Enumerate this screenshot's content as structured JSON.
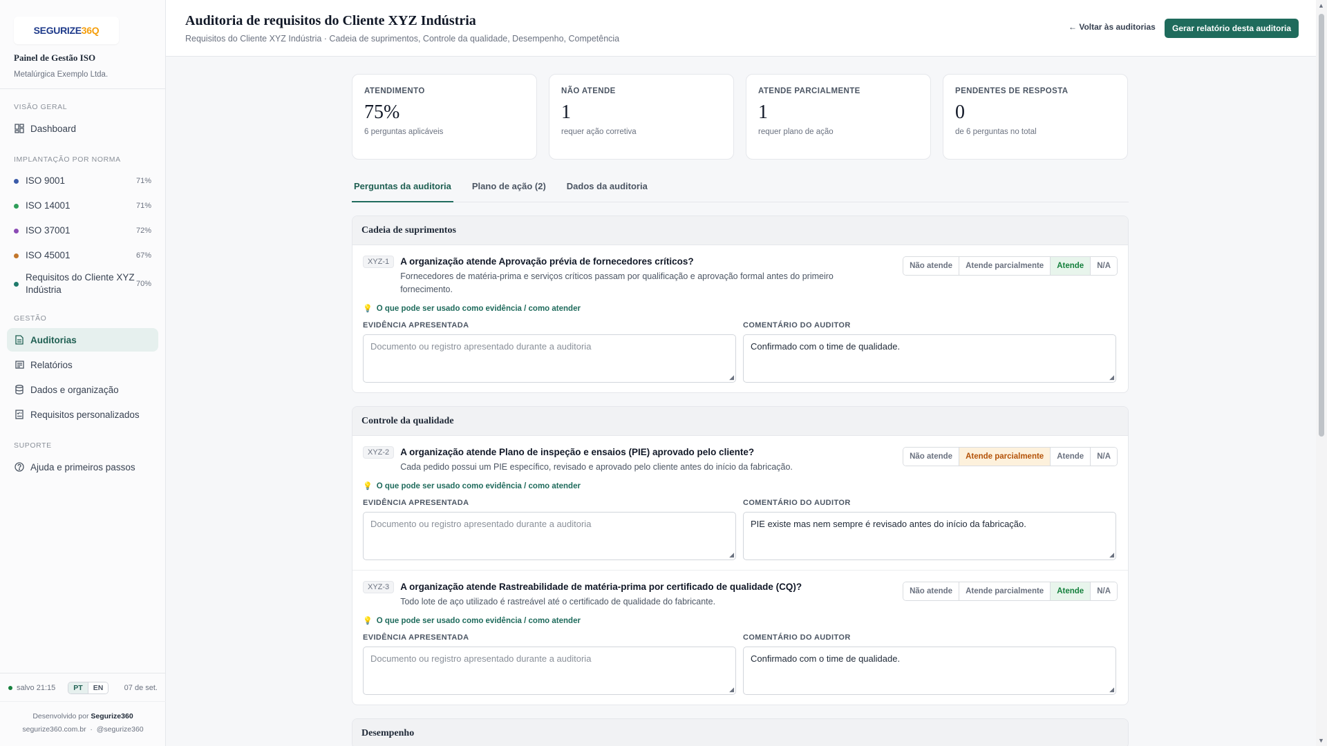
{
  "sidebar": {
    "logo": {
      "word": "SEGURIZE",
      "num": "36",
      "tail": "Q"
    },
    "panel_title": "Painel de Gestão ISO",
    "company": "Metalúrgica Exemplo Ltda.",
    "sections": {
      "overview": {
        "heading": "VISÃO GERAL",
        "dashboard": "Dashboard"
      },
      "norms": {
        "heading": "IMPLANTAÇÃO POR NORMA",
        "items": [
          {
            "label": "ISO 9001",
            "pct": "71%",
            "color": "#3b5ba9"
          },
          {
            "label": "ISO 14001",
            "pct": "71%",
            "color": "#2f9e5a"
          },
          {
            "label": "ISO 37001",
            "pct": "72%",
            "color": "#8b4bb5"
          },
          {
            "label": "ISO 45001",
            "pct": "67%",
            "color": "#c2762b"
          },
          {
            "label": "Requisitos do Cliente XYZ Indústria",
            "pct": "70%",
            "color": "#1f7a6b"
          }
        ]
      },
      "management": {
        "heading": "GESTÃO",
        "items": [
          "Auditorias",
          "Relatórios",
          "Dados e organização",
          "Requisitos personalizados"
        ]
      },
      "support": {
        "heading": "SUPORTE",
        "help": "Ajuda e primeiros passos"
      }
    },
    "footer": {
      "saved": "salvo 21:15",
      "lang_pt": "PT",
      "lang_en": "EN",
      "date": "07 de set.",
      "dev_prefix": "Desenvolvido por",
      "dev_name": "Segurize360",
      "site": "segurize360.com.br",
      "sep": "·",
      "handle": "@segurize360"
    }
  },
  "header": {
    "title": "Auditoria de requisitos do Cliente XYZ Indústria",
    "subtitle": "Requisitos do Cliente XYZ Indústria · Cadeia de suprimentos, Controle da qualidade, Desempenho, Competência",
    "back": "← Voltar às auditorias",
    "generate": "Gerar relatório desta auditoria"
  },
  "stats": [
    {
      "label": "ATENDIMENTO",
      "value": "75%",
      "sub": "6 perguntas aplicáveis"
    },
    {
      "label": "NÃO ATENDE",
      "value": "1",
      "sub": "requer ação corretiva"
    },
    {
      "label": "ATENDE PARCIALMENTE",
      "value": "1",
      "sub": "requer plano de ação"
    },
    {
      "label": "PENDENTES DE RESPOSTA",
      "value": "0",
      "sub": "de 6 perguntas no total"
    }
  ],
  "tabs": [
    "Perguntas da auditoria",
    "Plano de ação (2)",
    "Dados da auditoria"
  ],
  "answer_options": [
    "Não atende",
    "Atende parcialmente",
    "Atende",
    "N/A"
  ],
  "hint_text": "O que pode ser usado como evidência / como atender",
  "evidence_label": "EVIDÊNCIA APRESENTADA",
  "comment_label": "COMENTÁRIO DO AUDITOR",
  "evidence_placeholder": "Documento ou registro apresentado durante a auditoria",
  "groups": [
    {
      "title": "Cadeia de suprimentos",
      "questions": [
        {
          "code": "XYZ-1",
          "title": "A organização atende Aprovação prévia de fornecedores críticos?",
          "desc": "Fornecedores de matéria-prima e serviços críticos passam por qualificação e aprovação formal antes do primeiro fornecimento.",
          "selected": "Atende",
          "comment": "Confirmado com o time de qualidade."
        }
      ]
    },
    {
      "title": "Controle da qualidade",
      "questions": [
        {
          "code": "XYZ-2",
          "title": "A organização atende Plano de inspeção e ensaios (PIE) aprovado pelo cliente?",
          "desc": "Cada pedido possui um PIE específico, revisado e aprovado pelo cliente antes do início da fabricação.",
          "selected": "Atende parcialmente",
          "comment": "PIE existe mas nem sempre é revisado antes do início da fabricação."
        },
        {
          "code": "XYZ-3",
          "title": "A organização atende Rastreabilidade de matéria-prima por certificado de qualidade (CQ)?",
          "desc": "Todo lote de aço utilizado é rastreável até o certificado de qualidade do fabricante.",
          "selected": "Atende",
          "comment": "Confirmado com o time de qualidade."
        }
      ]
    },
    {
      "title": "Desempenho",
      "questions": []
    }
  ]
}
